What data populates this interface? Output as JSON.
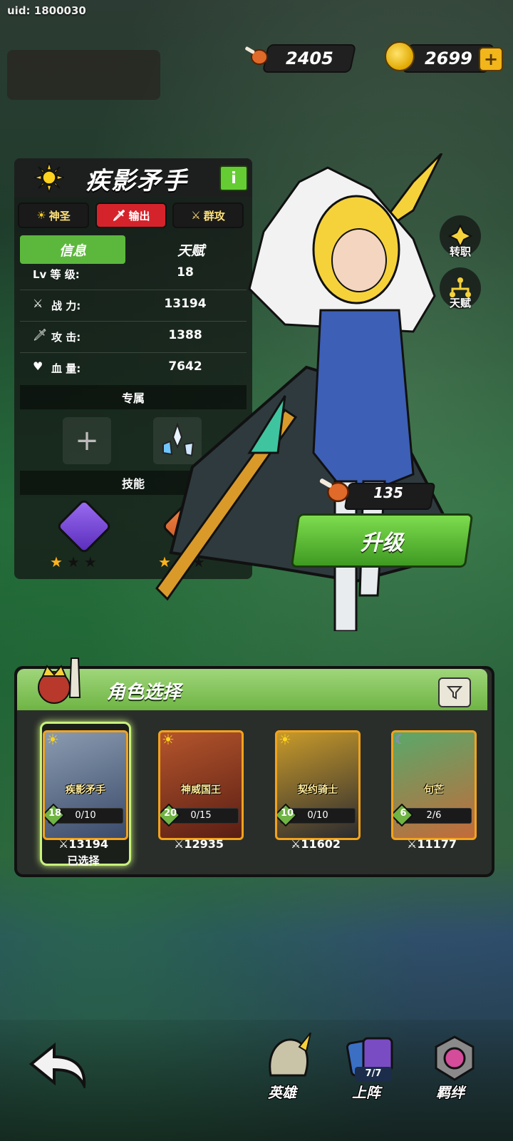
{
  "uid": "uid: 1800030",
  "resources": {
    "meat": "2405",
    "coins": "2699",
    "plus": "+"
  },
  "hero": {
    "name": "疾影矛手",
    "info_btn": "i",
    "tags": [
      "神圣",
      "输出",
      "群攻"
    ],
    "tabs": [
      "信息",
      "天赋"
    ],
    "stats": [
      {
        "label": "Lv 等 级:",
        "value": "18"
      },
      {
        "label": "战 力:",
        "value": "13194"
      },
      {
        "label": "攻 击:",
        "value": "1388"
      },
      {
        "label": "血 量:",
        "value": "7642"
      }
    ],
    "exclusive_label": "专属",
    "add_slot": "+",
    "skills_label": "技能",
    "skill1_stars": "★★★",
    "skill2_stars": "★★★"
  },
  "side": {
    "job": "转职",
    "talent": "天赋"
  },
  "upgrade": {
    "cost": "135",
    "label": "升级"
  },
  "select": {
    "title": "角色选择",
    "cards": [
      {
        "name": "疾影矛手",
        "level": "18",
        "progress": "0/10",
        "power": "13194",
        "selected": "已选择"
      },
      {
        "name": "神威国王",
        "level": "20",
        "progress": "0/15",
        "power": "12935"
      },
      {
        "name": "契约骑士",
        "level": "10",
        "progress": "0/10",
        "power": "11602"
      },
      {
        "name": "句芒",
        "level": "6",
        "progress": "2/6",
        "power": "11177"
      }
    ]
  },
  "nav": {
    "hero": "英雄",
    "deploy": "上阵",
    "bond": "羁绊",
    "deploy_badge": "7/7"
  },
  "colors": {
    "accent_green": "#5cb83c",
    "card_border": "#f1a31c",
    "tag_red": "#d5232b"
  }
}
